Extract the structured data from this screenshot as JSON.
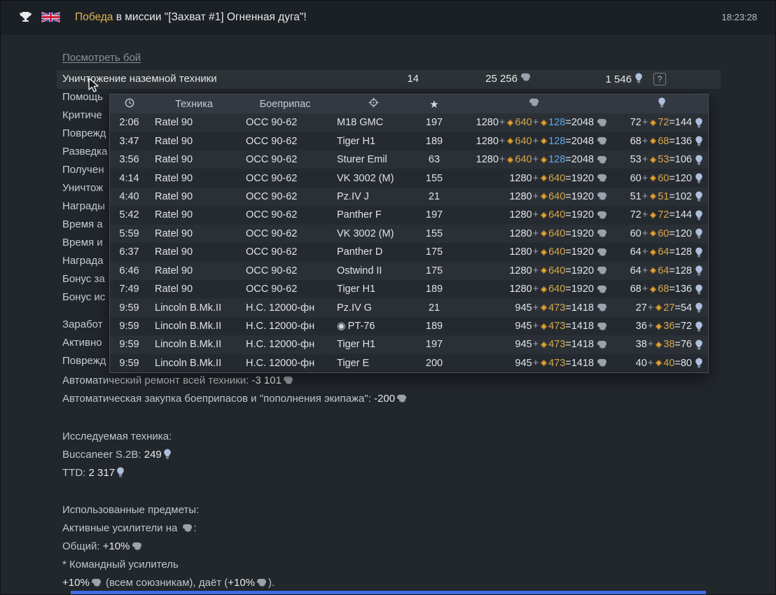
{
  "topbar": {
    "result_word": "Победа",
    "title_rest": " в миссии \"[Захват #1] Огненная дуга\"!",
    "time": "18:23:28"
  },
  "links": {
    "view_battle": "Посмотреть бой"
  },
  "summary_row": {
    "label": "Уничтожение наземной техники",
    "count": "14",
    "silver": "25 256",
    "rp": "1 546",
    "help_glyph": "?"
  },
  "left_rows": [
    {
      "label": "Помощь"
    },
    {
      "label": "Критиче"
    },
    {
      "label": "Поврежд"
    },
    {
      "label": "Разведка"
    },
    {
      "label": "Получен"
    },
    {
      "label": "Уничтож"
    },
    {
      "label": "Награды"
    },
    {
      "label": "Время а"
    },
    {
      "label": "Время и"
    },
    {
      "label": "Награда"
    },
    {
      "label": "Бонус за"
    },
    {
      "label": "Бонус ис"
    },
    {
      "spacer": true
    },
    {
      "label": "Заработ"
    },
    {
      "label": "Активно"
    },
    {
      "label": "Поврежд"
    }
  ],
  "battle_log": {
    "header": {
      "vehicle": "Техника",
      "ammo": "Боеприпас"
    },
    "rows": [
      {
        "time": "2:06",
        "vehicle": "Ratel 90",
        "ammo": "ОСС 90-62",
        "target": "M18 GMC",
        "score": "197",
        "sl": {
          "base": "1280",
          "prem": "640",
          "boost": "128",
          "total": "2048"
        },
        "rp": {
          "base": "72",
          "prem": "72",
          "total": "144"
        }
      },
      {
        "time": "3:47",
        "vehicle": "Ratel 90",
        "ammo": "ОСС 90-62",
        "target": "Tiger H1",
        "score": "189",
        "sl": {
          "base": "1280",
          "prem": "640",
          "boost": "128",
          "total": "2048"
        },
        "rp": {
          "base": "68",
          "prem": "68",
          "total": "136"
        }
      },
      {
        "time": "3:56",
        "vehicle": "Ratel 90",
        "ammo": "ОСС 90-62",
        "target": "Sturer Emil",
        "score": "63",
        "sl": {
          "base": "1280",
          "prem": "640",
          "boost": "128",
          "total": "2048"
        },
        "rp": {
          "base": "53",
          "prem": "53",
          "total": "106"
        }
      },
      {
        "time": "4:14",
        "vehicle": "Ratel 90",
        "ammo": "ОСС 90-62",
        "target": "VK 3002 (M)",
        "score": "155",
        "sl": {
          "base": "1280",
          "prem": "640",
          "total": "1920"
        },
        "rp": {
          "base": "60",
          "prem": "60",
          "total": "120"
        }
      },
      {
        "time": "4:40",
        "vehicle": "Ratel 90",
        "ammo": "ОСС 90-62",
        "target": "Pz.IV J",
        "score": "21",
        "sl": {
          "base": "1280",
          "prem": "640",
          "total": "1920"
        },
        "rp": {
          "base": "51",
          "prem": "51",
          "total": "102"
        }
      },
      {
        "time": "5:42",
        "vehicle": "Ratel 90",
        "ammo": "ОСС 90-62",
        "target": "Panther F",
        "score": "197",
        "sl": {
          "base": "1280",
          "prem": "640",
          "total": "1920"
        },
        "rp": {
          "base": "72",
          "prem": "72",
          "total": "144"
        }
      },
      {
        "time": "5:59",
        "vehicle": "Ratel 90",
        "ammo": "ОСС 90-62",
        "target": "VK 3002 (M)",
        "score": "155",
        "sl": {
          "base": "1280",
          "prem": "640",
          "total": "1920"
        },
        "rp": {
          "base": "60",
          "prem": "60",
          "total": "120"
        }
      },
      {
        "time": "6:37",
        "vehicle": "Ratel 90",
        "ammo": "ОСС 90-62",
        "target": "Panther D",
        "score": "175",
        "sl": {
          "base": "1280",
          "prem": "640",
          "total": "1920"
        },
        "rp": {
          "base": "64",
          "prem": "64",
          "total": "128"
        }
      },
      {
        "time": "6:46",
        "vehicle": "Ratel 90",
        "ammo": "ОСС 90-62",
        "target": "Ostwind II",
        "score": "175",
        "sl": {
          "base": "1280",
          "prem": "640",
          "total": "1920"
        },
        "rp": {
          "base": "64",
          "prem": "64",
          "total": "128"
        }
      },
      {
        "time": "7:49",
        "vehicle": "Ratel 90",
        "ammo": "ОСС 90-62",
        "target": "Tiger H1",
        "score": "189",
        "sl": {
          "base": "1280",
          "prem": "640",
          "total": "1920"
        },
        "rp": {
          "base": "68",
          "prem": "68",
          "total": "136"
        }
      },
      {
        "time": "9:59",
        "vehicle": "Lincoln B.Mk.II",
        "ammo": "Н.С. 12000-фн",
        "target": "Pz.IV G",
        "score": "21",
        "sl": {
          "base": "945",
          "prem": "473",
          "total": "1418"
        },
        "rp": {
          "base": "27",
          "prem": "27",
          "total": "54"
        }
      },
      {
        "time": "9:59",
        "vehicle": "Lincoln B.Mk.II",
        "ammo": "Н.С. 12000-фн",
        "target": "PT-76",
        "marker": true,
        "score": "189",
        "sl": {
          "base": "945",
          "prem": "473",
          "total": "1418"
        },
        "rp": {
          "base": "36",
          "prem": "36",
          "total": "72"
        }
      },
      {
        "time": "9:59",
        "vehicle": "Lincoln B.Mk.II",
        "ammo": "Н.С. 12000-фн",
        "target": "Tiger H1",
        "score": "197",
        "sl": {
          "base": "945",
          "prem": "473",
          "total": "1418"
        },
        "rp": {
          "base": "38",
          "prem": "38",
          "total": "76"
        }
      },
      {
        "time": "9:59",
        "vehicle": "Lincoln B.Mk.II",
        "ammo": "Н.С. 12000-фн",
        "target": "Tiger E",
        "score": "200",
        "sl": {
          "base": "945",
          "prem": "473",
          "total": "1418"
        },
        "rp": {
          "base": "40",
          "prem": "40",
          "total": "80"
        }
      }
    ]
  },
  "footer_lines": [
    {
      "name": "auto-repair-line",
      "segments": [
        {
          "t": "Автоматический ремонт всей техники: "
        },
        {
          "t": "-3 101",
          "v": true
        },
        {
          "i": "lion"
        }
      ]
    },
    {
      "name": "auto-ammo-line",
      "segments": [
        {
          "t": "Автоматическая закупка боеприпасов и \"пополнения экипажа\": "
        },
        {
          "t": "-200",
          "v": true
        },
        {
          "i": "lion"
        }
      ]
    },
    {
      "spacer": 28
    },
    {
      "name": "research-header",
      "segments": [
        {
          "t": "Исследуемая техника:"
        }
      ]
    },
    {
      "name": "research-buccaneer",
      "segments": [
        {
          "t": "Buccaneer S.2B: "
        },
        {
          "t": "249",
          "v": true
        },
        {
          "i": "bulb"
        }
      ]
    },
    {
      "name": "research-ttd",
      "segments": [
        {
          "t": "TTD: "
        },
        {
          "t": "2 317",
          "v": true
        },
        {
          "i": "bulb"
        }
      ]
    },
    {
      "spacer": 27
    },
    {
      "name": "items-header",
      "segments": [
        {
          "t": "Использованные предметы:"
        }
      ]
    },
    {
      "name": "boosters-line",
      "segments": [
        {
          "t": "Активные усилители на "
        },
        {
          "i": "lion"
        },
        {
          "t": ":"
        }
      ]
    },
    {
      "name": "booster-common",
      "segments": [
        {
          "t": "Общий: "
        },
        {
          "t": "+10%",
          "v": true
        },
        {
          "i": "lion"
        }
      ]
    },
    {
      "name": "booster-note-1",
      "segments": [
        {
          "t": "* Командный усилитель"
        }
      ]
    },
    {
      "name": "booster-note-2",
      "segments": [
        {
          "t": "+10%",
          "v": true
        },
        {
          "i": "lion"
        },
        {
          "t": " (всем союзникам), даёт ("
        },
        {
          "t": "+10%",
          "v": true
        },
        {
          "i": "lion"
        },
        {
          "t": ")."
        }
      ]
    }
  ],
  "icons": {
    "star_glyph": "★",
    "target_marker_glyph": "◉"
  },
  "colors": {
    "gold": "#d7a84a",
    "blue": "#61a8e4",
    "victory": "#e3b64e",
    "bottom_bar": "#3e6de2"
  }
}
